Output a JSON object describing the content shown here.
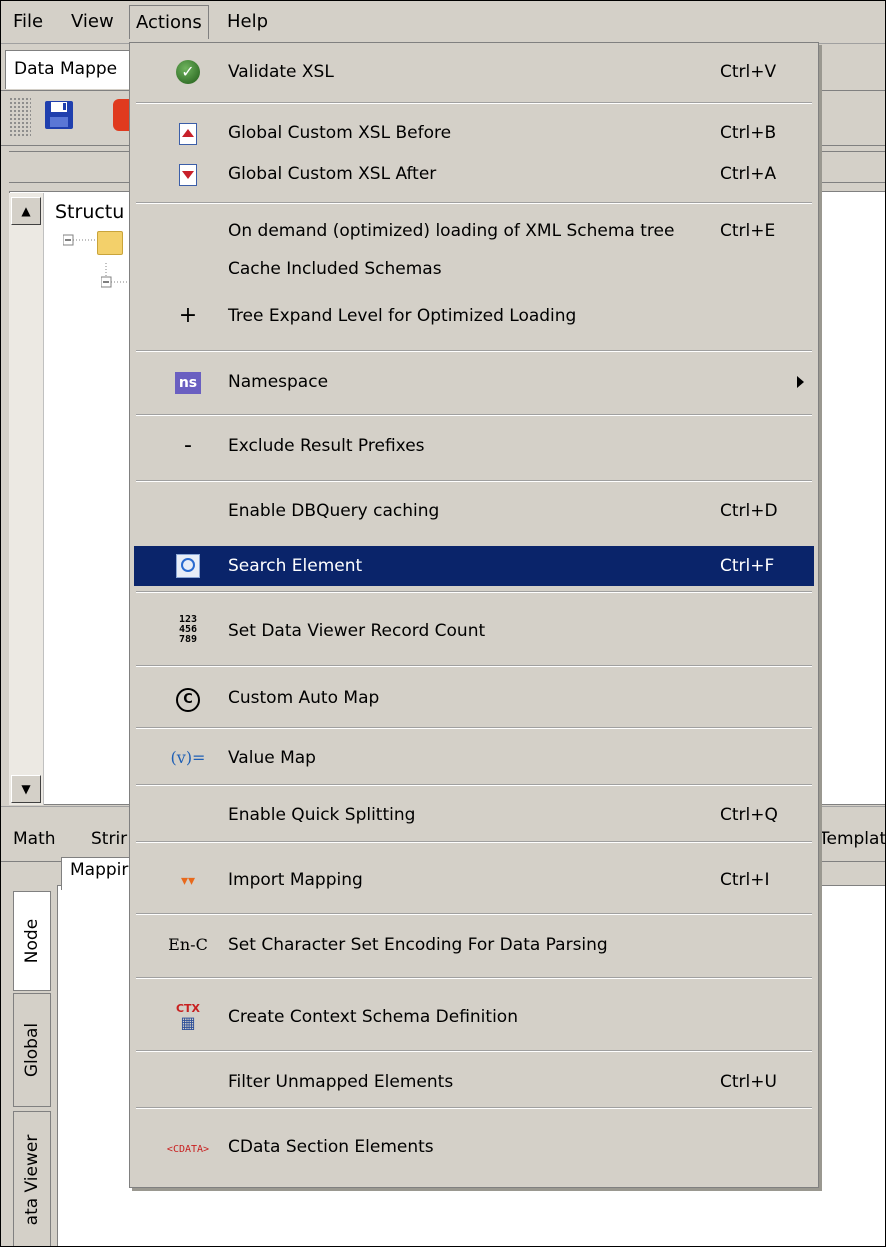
{
  "menubar": {
    "items": [
      "File",
      "View",
      "Actions",
      "Help"
    ]
  },
  "tabs": {
    "data_mapper": "Data Mappe"
  },
  "tree": {
    "root_label": "Structu"
  },
  "bottom_tabs": [
    "Math",
    "Strir",
    "Templat"
  ],
  "mapping_tab": "Mappir",
  "vertical_tabs": [
    "Node",
    "Global",
    "ata Viewer"
  ],
  "icons": {
    "import_arrows": "▾▾",
    "enc": "En-C",
    "cdata": "<CDATA>"
  },
  "menu": {
    "items": [
      {
        "icon": "validate-check-icon",
        "label": "Validate XSL",
        "shortcut": "Ctrl+V"
      },
      {
        "icon": "custom-xsl-before-icon",
        "label": "Global Custom XSL Before",
        "shortcut": "Ctrl+B"
      },
      {
        "icon": "custom-xsl-after-icon",
        "label": "Global Custom XSL After",
        "shortcut": "Ctrl+A"
      },
      {
        "icon": "",
        "label": "On demand (optimized) loading of XML Schema tree",
        "shortcut": "Ctrl+E"
      },
      {
        "icon": "",
        "label": "Cache Included Schemas",
        "shortcut": ""
      },
      {
        "icon": "plus-icon",
        "label": "Tree Expand Level for Optimized Loading",
        "shortcut": ""
      },
      {
        "icon": "namespace-icon",
        "label": "Namespace",
        "shortcut": "",
        "submenu": true
      },
      {
        "icon": "minus-icon",
        "label": "Exclude Result Prefixes",
        "shortcut": ""
      },
      {
        "icon": "",
        "label": "Enable DBQuery caching",
        "shortcut": "Ctrl+D"
      },
      {
        "icon": "search-element-icon",
        "label": "Search Element",
        "shortcut": "Ctrl+F",
        "highlighted": true
      },
      {
        "icon": "record-count-icon",
        "label": "Set Data Viewer Record Count",
        "shortcut": ""
      },
      {
        "icon": "custom-auto-map-icon",
        "label": "Custom Auto Map",
        "shortcut": ""
      },
      {
        "icon": "value-map-icon",
        "label": "Value Map",
        "shortcut": ""
      },
      {
        "icon": "",
        "label": "Enable Quick Splitting",
        "shortcut": "Ctrl+Q"
      },
      {
        "icon": "import-mapping-icon",
        "label": "Import Mapping",
        "shortcut": "Ctrl+I"
      },
      {
        "icon": "encoding-icon",
        "label": "Set Character Set Encoding For Data Parsing",
        "shortcut": ""
      },
      {
        "icon": "context-schema-icon",
        "label": "Create Context Schema Definition",
        "shortcut": ""
      },
      {
        "icon": "",
        "label": "Filter Unmapped Elements",
        "shortcut": "Ctrl+U"
      },
      {
        "icon": "cdata-icon",
        "label": "CData Section Elements",
        "shortcut": ""
      }
    ]
  },
  "colors": {
    "highlight": "#0a246a",
    "face": "#d4d0c8"
  }
}
